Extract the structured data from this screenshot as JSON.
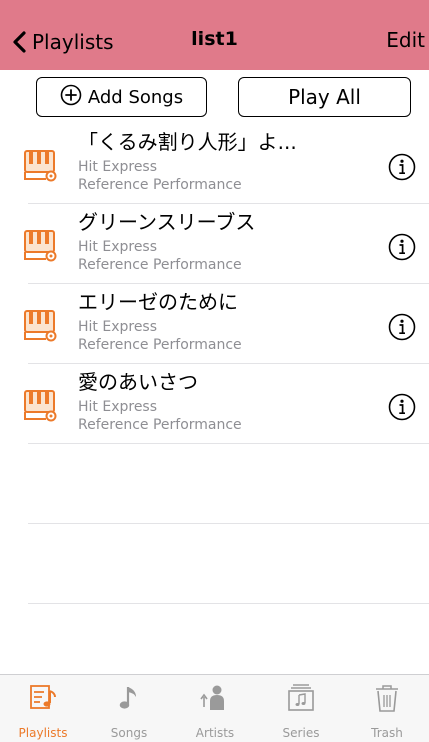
{
  "nav": {
    "back_label": "Playlists",
    "title": "list1",
    "edit_label": "Edit"
  },
  "actions": {
    "add_songs_label": "Add Songs",
    "play_all_label": "Play All"
  },
  "songs": [
    {
      "title": "「くるみ割り人形」よ...",
      "album": "Hit Express",
      "performance": "Reference Performance"
    },
    {
      "title": "グリーンスリーブス",
      "album": "Hit Express",
      "performance": "Reference Performance"
    },
    {
      "title": "エリーゼのために",
      "album": "Hit Express",
      "performance": "Reference Performance"
    },
    {
      "title": "愛のあいさつ",
      "album": "Hit Express",
      "performance": "Reference Performance"
    }
  ],
  "tabs": [
    {
      "label": "Playlists",
      "icon": "playlist-icon",
      "active": true
    },
    {
      "label": "Songs",
      "icon": "music-note-icon",
      "active": false
    },
    {
      "label": "Artists",
      "icon": "artist-icon",
      "active": false
    },
    {
      "label": "Series",
      "icon": "series-icon",
      "active": false
    },
    {
      "label": "Trash",
      "icon": "trash-icon",
      "active": false
    }
  ],
  "colors": {
    "nav_background": "#e07a8a",
    "accent": "#ec7a2a",
    "secondary_text": "#8e8e93"
  }
}
